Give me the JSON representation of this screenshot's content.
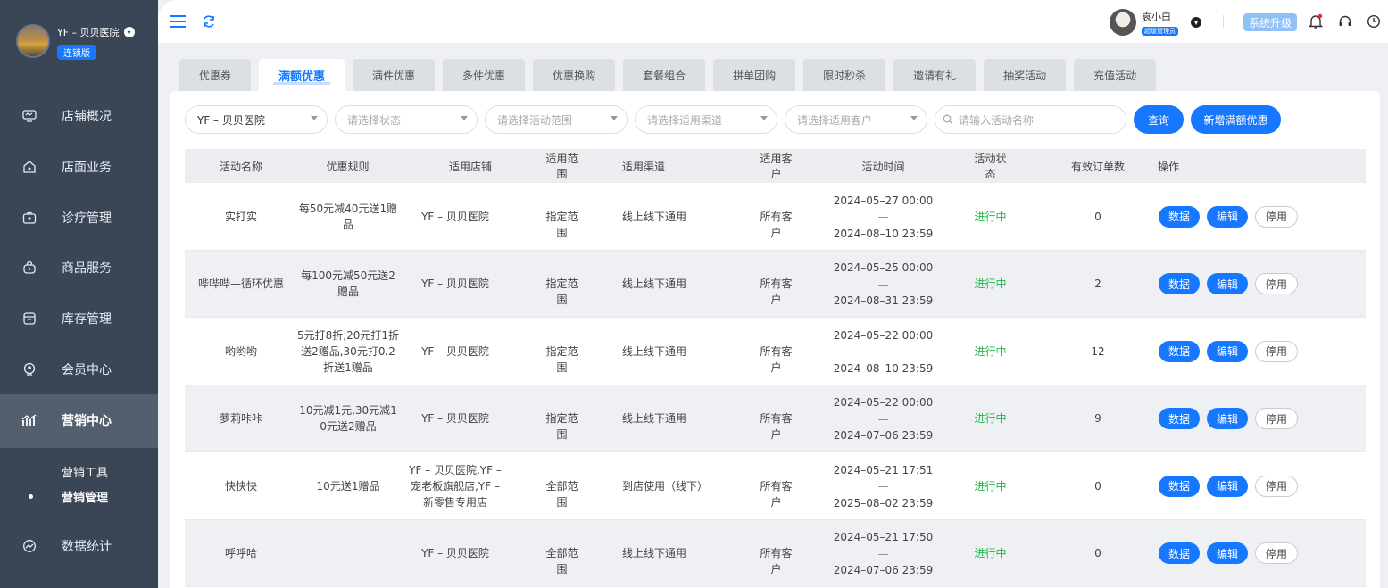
{
  "brand": {
    "name": "YF – 贝贝医院",
    "badge": "连锁版"
  },
  "sidebar": {
    "items": [
      {
        "label": "店铺概况",
        "icon": "monitor-icon"
      },
      {
        "label": "店面业务",
        "icon": "house-icon"
      },
      {
        "label": "诊疗管理",
        "icon": "medical-kit-icon"
      },
      {
        "label": "商品服务",
        "icon": "bag-icon"
      },
      {
        "label": "库存管理",
        "icon": "box-icon"
      },
      {
        "label": "会员中心",
        "icon": "member-icon"
      },
      {
        "label": "营销中心",
        "icon": "chart-bars-icon",
        "active": true
      },
      {
        "label": "数据统计",
        "icon": "trend-icon"
      }
    ],
    "subitems": [
      {
        "label": "营销工具"
      },
      {
        "label": "营销管理",
        "active": true
      }
    ]
  },
  "topbar": {
    "user_name": "袁小白",
    "user_role": "超级管理员",
    "upgrade_label": "系统升级"
  },
  "tabs": [
    "优惠券",
    "满额优惠",
    "满件优惠",
    "多件优惠",
    "优惠换购",
    "套餐组合",
    "拼单团购",
    "限时秒杀",
    "邀请有礼",
    "抽奖活动",
    "充值活动"
  ],
  "active_tab": "满额优惠",
  "filters": {
    "store": "YF – 贝贝医院",
    "status_placeholder": "请选择状态",
    "scope_placeholder": "请选择活动范围",
    "channel_placeholder": "请选择适用渠道",
    "customer_placeholder": "请选择适用客户",
    "search_placeholder": "请输入活动名称",
    "query_label": "查询",
    "add_label": "新增满额优惠"
  },
  "table": {
    "headers": [
      "活动名称",
      "优惠规则",
      "适用店铺",
      "适用范围",
      "适用渠道",
      "适用客户",
      "活动时间",
      "活动状态",
      "有效订单数",
      "操作"
    ],
    "rows": [
      {
        "name": "实打实",
        "rule": [
          "每50元减40元送1赠",
          "品"
        ],
        "store": [
          "YF – 贝贝医院"
        ],
        "scope": "指定范围",
        "channel": "线上线下通用",
        "customer": "所有客户",
        "start": "2024–05–27 00:00",
        "sep": "—",
        "end": "2024–08–10 23:59",
        "status": "进行中",
        "orders": "0"
      },
      {
        "name": "哔哔哔—循环优惠",
        "rule": [
          "每100元减50元送2",
          "赠品"
        ],
        "store": [
          "YF – 贝贝医院"
        ],
        "scope": "指定范围",
        "channel": "线上线下通用",
        "customer": "所有客户",
        "start": "2024–05–25 00:00",
        "sep": "—",
        "end": "2024–08–31 23:59",
        "status": "进行中",
        "orders": "2"
      },
      {
        "name": "哟哟哟",
        "rule": [
          "5元打8折,20元打1折",
          "送2赠品,30元打0.2",
          "折送1赠品"
        ],
        "store": [
          "YF – 贝贝医院"
        ],
        "scope": "指定范围",
        "channel": "线上线下通用",
        "customer": "所有客户",
        "start": "2024–05–22 00:00",
        "sep": "—",
        "end": "2024–08–10 23:59",
        "status": "进行中",
        "orders": "12"
      },
      {
        "name": "萝莉咔咔",
        "rule": [
          "10元减1元,30元减1",
          "0元送2赠品"
        ],
        "store": [
          "YF – 贝贝医院"
        ],
        "scope": "指定范围",
        "channel": "线上线下通用",
        "customer": "所有客户",
        "start": "2024–05–22 00:00",
        "sep": "—",
        "end": "2024–07–06 23:59",
        "status": "进行中",
        "orders": "9"
      },
      {
        "name": "快快快",
        "rule": [
          "10元送1赠品"
        ],
        "store": [
          "YF – 贝贝医院,YF –",
          "宠老板旗舰店,YF –",
          "新零售专用店"
        ],
        "scope": "全部范围",
        "channel": "到店使用（线下）",
        "customer": "所有客户",
        "start": "2024–05–21 17:51",
        "sep": "—",
        "end": "2025–08–02 23:59",
        "status": "进行中",
        "orders": "0"
      },
      {
        "name": "呼呼哈",
        "rule": [],
        "store": [
          "YF – 贝贝医院"
        ],
        "scope": "全部范围",
        "channel": "线上线下通用",
        "customer": "所有客户",
        "start": "2024–05–21 17:50",
        "sep": "—",
        "end": "2024–07–06 23:59",
        "status": "进行中",
        "orders": "0"
      }
    ],
    "actions": {
      "data": "数据",
      "edit": "编辑",
      "stop": "停用"
    }
  },
  "colors": {
    "primary": "#1677ff",
    "sidebar": "#3a4555",
    "status_green": "#27b44b"
  }
}
